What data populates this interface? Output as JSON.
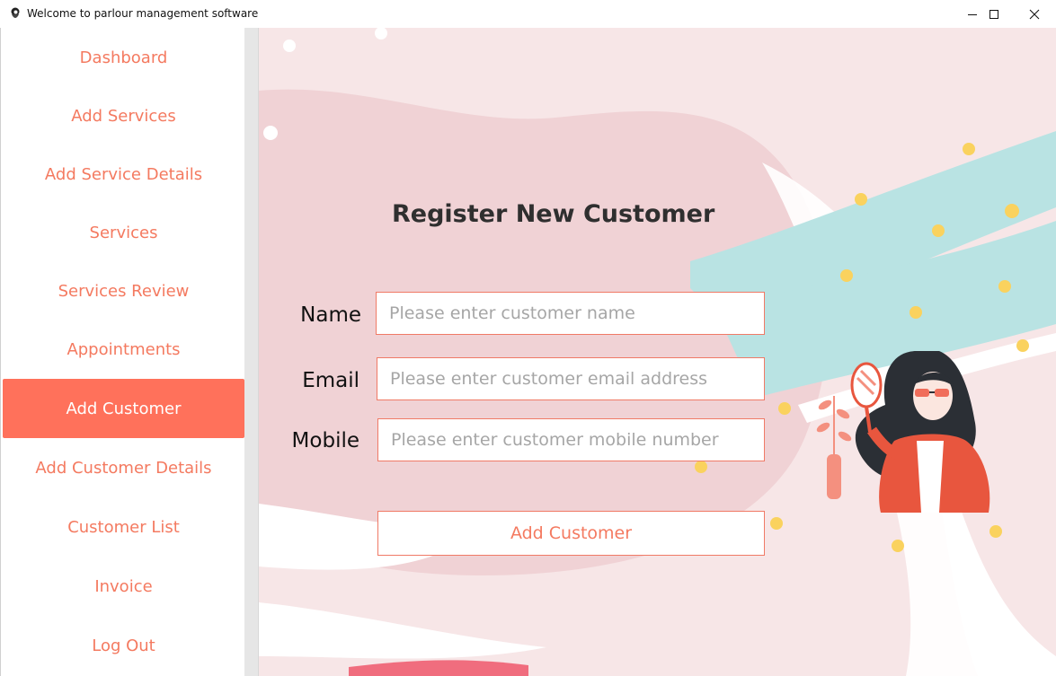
{
  "window": {
    "title": "Welcome to parlour management software",
    "icon": "parlour-logo-icon",
    "controls": [
      "minimize-icon",
      "maximize-icon",
      "close-icon"
    ]
  },
  "sidebar": {
    "items": [
      {
        "label": "Dashboard",
        "active": false
      },
      {
        "label": "Add Services",
        "active": false
      },
      {
        "label": "Add Service Details",
        "active": false
      },
      {
        "label": "Services",
        "active": false
      },
      {
        "label": "Services Review",
        "active": false
      },
      {
        "label": "Appointments",
        "active": false
      },
      {
        "label": "Add Customer",
        "active": true
      },
      {
        "label": "Add Customer Details",
        "active": false
      },
      {
        "label": "Customer List",
        "active": false
      },
      {
        "label": "Invoice",
        "active": false
      },
      {
        "label": "Log Out",
        "active": false
      }
    ]
  },
  "form": {
    "title": "Register New Customer",
    "fields": [
      {
        "label": "Name",
        "placeholder": "Please enter customer name",
        "value": ""
      },
      {
        "label": "Email",
        "placeholder": "Please enter customer email address",
        "value": ""
      },
      {
        "label": "Mobile",
        "placeholder": "Please enter customer mobile number",
        "value": ""
      }
    ],
    "submit_label": "Add Customer"
  },
  "colors": {
    "accent": "#ff715b",
    "accent_text": "#f47a60",
    "background_pink": "#f2d3d6",
    "brush_teal": "#b9e3e3",
    "dot_yellow": "#fad25e"
  }
}
